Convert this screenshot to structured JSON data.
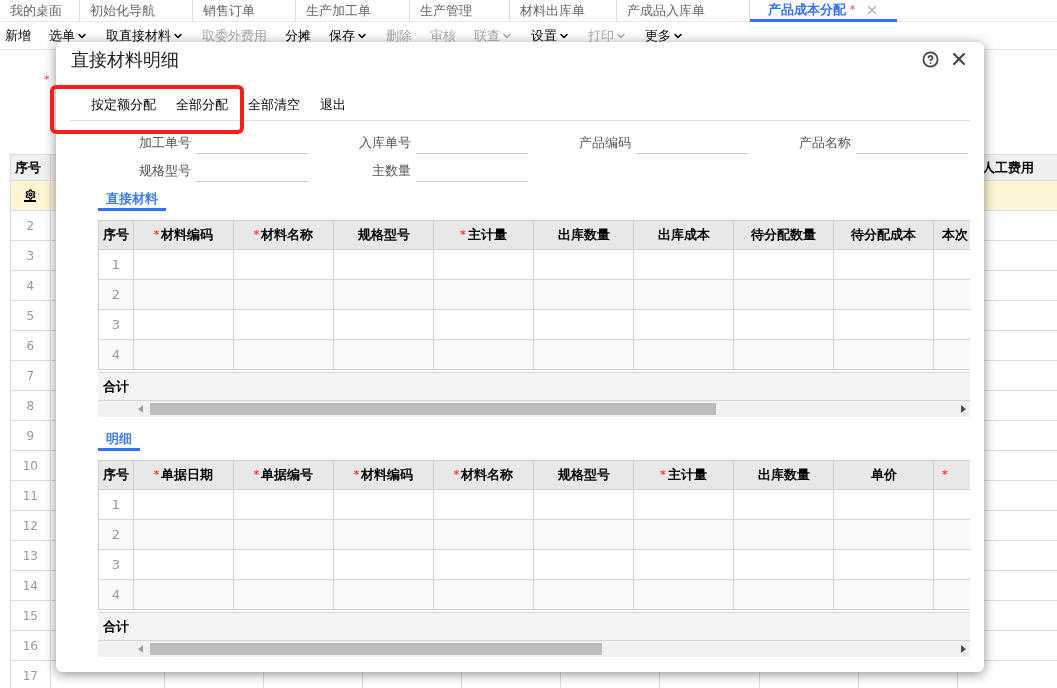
{
  "app_tabs": [
    {
      "label": "我的桌面",
      "selected": false,
      "closable": false
    },
    {
      "label": "初始化导航",
      "selected": false,
      "closable": false
    },
    {
      "label": "销售订单",
      "selected": false,
      "closable": false
    },
    {
      "label": "生产加工单",
      "selected": false,
      "closable": false
    },
    {
      "label": "生产管理",
      "selected": false,
      "closable": false
    },
    {
      "label": "材料出库单",
      "selected": false,
      "closable": false
    },
    {
      "label": "产成品入库单",
      "selected": false,
      "closable": false
    },
    {
      "label": "产品成本分配",
      "selected": true,
      "marker": "*",
      "closable": true
    }
  ],
  "toolbar": [
    {
      "label": "新增",
      "dropdown": false,
      "disabled": false
    },
    {
      "label": "选单",
      "dropdown": true,
      "disabled": false
    },
    {
      "label": "取直接材料",
      "dropdown": true,
      "disabled": false
    },
    {
      "label": "取委外费用",
      "dropdown": false,
      "disabled": true
    },
    {
      "label": "分摊",
      "dropdown": false,
      "disabled": false
    },
    {
      "label": "保存",
      "dropdown": true,
      "disabled": false
    },
    {
      "label": "删除",
      "dropdown": false,
      "disabled": true
    },
    {
      "label": "审核",
      "dropdown": false,
      "disabled": true
    },
    {
      "label": "联查",
      "dropdown": true,
      "disabled": true
    },
    {
      "label": "设置",
      "dropdown": true,
      "disabled": false
    },
    {
      "label": "打印",
      "dropdown": true,
      "disabled": true
    },
    {
      "label": "更多",
      "dropdown": true,
      "disabled": false
    }
  ],
  "required_mark": "*",
  "background_table": {
    "first_header": "序号",
    "last_header": "人工费用",
    "rows": [
      {
        "kind": "current",
        "selected": true
      },
      {
        "kind": "number",
        "index": "2",
        "selected": false
      },
      {
        "kind": "number",
        "index": "3",
        "selected": false
      },
      {
        "kind": "number",
        "index": "4",
        "selected": false
      },
      {
        "kind": "number",
        "index": "5",
        "selected": false
      },
      {
        "kind": "number",
        "index": "6",
        "selected": false
      },
      {
        "kind": "number",
        "index": "7",
        "selected": false
      },
      {
        "kind": "number",
        "index": "8",
        "selected": false
      },
      {
        "kind": "number",
        "index": "9",
        "selected": false
      },
      {
        "kind": "number",
        "index": "10",
        "selected": false
      },
      {
        "kind": "number",
        "index": "11",
        "selected": false
      },
      {
        "kind": "number",
        "index": "12",
        "selected": false
      },
      {
        "kind": "number",
        "index": "13",
        "selected": false
      },
      {
        "kind": "number",
        "index": "14",
        "selected": false
      },
      {
        "kind": "number",
        "index": "15",
        "selected": false
      },
      {
        "kind": "number",
        "index": "16",
        "selected": false
      },
      {
        "kind": "number",
        "index": "17",
        "selected": false
      }
    ]
  },
  "dialog": {
    "title": "直接材料明细",
    "actions": [
      {
        "label": "按定额分配",
        "highlighted": true
      },
      {
        "label": "全部分配",
        "highlighted": true
      },
      {
        "label": "全部清空",
        "highlighted": false
      },
      {
        "label": "退出",
        "highlighted": false
      }
    ],
    "fields": [
      {
        "label": "加工单号"
      },
      {
        "label": "入库单号"
      },
      {
        "label": "产品编码"
      },
      {
        "label": "产品名称"
      },
      {
        "label": "规格型号"
      },
      {
        "label": "主数量"
      }
    ],
    "sections": [
      {
        "tab": "直接材料",
        "selected": true,
        "columns": [
          {
            "label": "序号",
            "required": false
          },
          {
            "label": "材料编码",
            "required": true
          },
          {
            "label": "材料名称",
            "required": true
          },
          {
            "label": "规格型号",
            "required": false
          },
          {
            "label": "主计量",
            "required": true
          },
          {
            "label": "出库数量",
            "required": false
          },
          {
            "label": "出库成本",
            "required": false
          },
          {
            "label": "待分配数量",
            "required": false
          },
          {
            "label": "待分配成本",
            "required": false
          },
          {
            "label": "本次",
            "required": false
          }
        ],
        "rows": [
          "1",
          "2",
          "3",
          "4"
        ],
        "footer": "合计"
      },
      {
        "tab": "明细",
        "selected": true,
        "columns": [
          {
            "label": "序号",
            "required": false
          },
          {
            "label": "单据日期",
            "required": true
          },
          {
            "label": "单据编号",
            "required": true
          },
          {
            "label": "材料编码",
            "required": true
          },
          {
            "label": "材料名称",
            "required": true
          },
          {
            "label": "规格型号",
            "required": false
          },
          {
            "label": "主计量",
            "required": true
          },
          {
            "label": "出库数量",
            "required": false
          },
          {
            "label": "单价",
            "required": false
          },
          {
            "required": true
          }
        ],
        "rows": [
          "1",
          "2",
          "3",
          "4"
        ],
        "footer": "合计"
      }
    ]
  }
}
